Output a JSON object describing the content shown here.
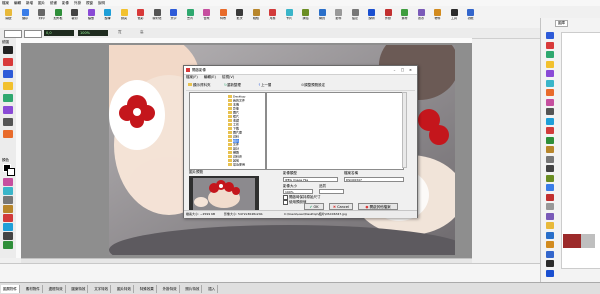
{
  "menubar": {
    "items": [
      "檔案",
      "編輯",
      "新增",
      "圖片",
      "繪畫",
      "影像",
      "外掛",
      "視窗",
      "說明"
    ]
  },
  "toolbar": {
    "buttons": [
      {
        "label": "開啟",
        "color": "#e8b93a",
        "icon": "folder-open-icon"
      },
      {
        "label": "儲存",
        "color": "#3a7de8",
        "icon": "save-icon"
      },
      {
        "label": "列印",
        "color": "#666666",
        "icon": "print-icon"
      },
      {
        "label": "加外框",
        "color": "#2f8f3a",
        "icon": "frame-icon"
      },
      {
        "label": "裁切",
        "color": "#444444",
        "icon": "crop-icon"
      },
      {
        "label": "縮放",
        "color": "#8a4ad6",
        "icon": "resize-icon"
      },
      {
        "label": "旋轉",
        "color": "#1f9fd8",
        "icon": "rotate-icon"
      },
      {
        "label": "調亮",
        "color": "#f2c12e",
        "icon": "brightness-icon"
      },
      {
        "label": "色彩",
        "color": "#d83a3a",
        "icon": "color-icon"
      },
      {
        "label": "銳利化",
        "color": "#555555",
        "icon": "sharpen-icon"
      },
      {
        "label": "文字",
        "color": "#2e5bd8",
        "icon": "text-icon"
      },
      {
        "label": "去背",
        "color": "#2fa86f",
        "icon": "cutout-icon"
      },
      {
        "label": "合成",
        "color": "#c64f9f",
        "icon": "composite-icon"
      },
      {
        "label": "特效",
        "color": "#e86b2b",
        "icon": "effect-icon"
      },
      {
        "label": "批次",
        "color": "#3a3a3a",
        "icon": "batch-icon"
      },
      {
        "label": "相框",
        "color": "#b8862b",
        "icon": "photo-frame-icon"
      },
      {
        "label": "月曆",
        "color": "#d23b3b",
        "icon": "calendar-icon"
      },
      {
        "label": "卡片",
        "color": "#3ab5c9",
        "icon": "card-icon"
      },
      {
        "label": "拼貼",
        "color": "#6b8e23",
        "icon": "collage-icon"
      },
      {
        "label": "網頁",
        "color": "#2a6fc9",
        "icon": "web-icon"
      },
      {
        "label": "郵件",
        "color": "#999999",
        "icon": "mail-icon"
      },
      {
        "label": "設定",
        "color": "#777777",
        "icon": "gear-icon"
      },
      {
        "label": "說明",
        "color": "#1a4fd0",
        "icon": "help-icon"
      },
      {
        "label": "外掛",
        "color": "#c23030",
        "icon": "plugin-icon"
      },
      {
        "label": "素材",
        "color": "#3f9d3f",
        "icon": "material-icon"
      },
      {
        "label": "遮罩",
        "color": "#7a5ab8",
        "icon": "mask-icon"
      },
      {
        "label": "物件",
        "color": "#d28b1f",
        "icon": "object-icon"
      },
      {
        "label": "工具",
        "color": "#2b2b2b",
        "icon": "tool-icon"
      },
      {
        "label": "功能",
        "color": "#3366cc",
        "icon": "function-icon"
      }
    ]
  },
  "subbar": {
    "field1": "0,0",
    "field2": "100%",
    "text1": "寬",
    "text2": "高"
  },
  "leftpanel": {
    "label1": "繪圖",
    "label2": "顏色",
    "tools": [
      "#222222",
      "#d83a3a",
      "#2e5bd8",
      "#f2c12e",
      "#2fa86f",
      "#8a4ad6",
      "#555555",
      "#e86b2b",
      "#c64f9f",
      "#3ab5c9",
      "#777777",
      "#b8862b",
      "#d23b3b",
      "#1f9fd8",
      "#444444",
      "#2f8f3a"
    ]
  },
  "rightpanel": {
    "tab": "圖庫",
    "tools": [
      "#2e5bd8",
      "#d83a3a",
      "#2fa86f",
      "#f2c12e",
      "#8a4ad6",
      "#3ab5c9",
      "#e86b2b",
      "#c64f9f",
      "#555555",
      "#1f9fd8",
      "#d23b3b",
      "#2f8f3a",
      "#b8862b",
      "#777777",
      "#444444",
      "#6b8e23",
      "#3a7de8",
      "#c23030",
      "#999999",
      "#7a5ab8",
      "#e8b93a",
      "#2a6fc9",
      "#d28b1f",
      "#3366cc",
      "#2b2b2b",
      "#1a4fd0"
    ]
  },
  "dialog": {
    "title": "開啟影像",
    "menu": [
      "檔案(F)",
      "編輯(E)",
      "檢視(V)"
    ],
    "toolbar": [
      "顯示資料夾",
      "重新整理",
      "上一層",
      "",
      "調整預覽設定"
    ],
    "tree": [
      "Desktop",
      "我的文件",
      "本機",
      "影像",
      "圖片",
      "照片",
      "收藏",
      "工作",
      "下載",
      "圖片庫",
      "資料",
      "相片",
      "文件",
      "設計",
      "網路",
      "資料夾",
      "其他",
      "最近使用"
    ],
    "tree_selected": "相片",
    "preview_label": "圖片預覽",
    "filetype_label": "影像類型",
    "filetype_value": "JPEG Image File",
    "path_label": "檔案名稱",
    "path_value": "DSC06347",
    "size_label": "影像大小",
    "size_value": "100%",
    "quality_label": "品質",
    "quality_value": "",
    "check1": "開啟時保持原始尺寸",
    "check2": "使用預設值",
    "btn_ok": "OK",
    "btn_cancel": "Cancel",
    "btn_other": "開啟其他檔案",
    "status_left": "檔案大小: ~2599 KB",
    "status_mid": "影像大小: 5472x3648x24b",
    "status_right": "C:\\Users\\user\\Desktop\\相片\\DSC06347.jpg"
  },
  "statusbar": {
    "tabs": [
      "圖層物件",
      "素材物件",
      "邊框特效",
      "圖案特效",
      "文字特效",
      "圖片特效",
      "特殊效果",
      "外掛特效",
      "照片特效",
      "插入"
    ]
  }
}
